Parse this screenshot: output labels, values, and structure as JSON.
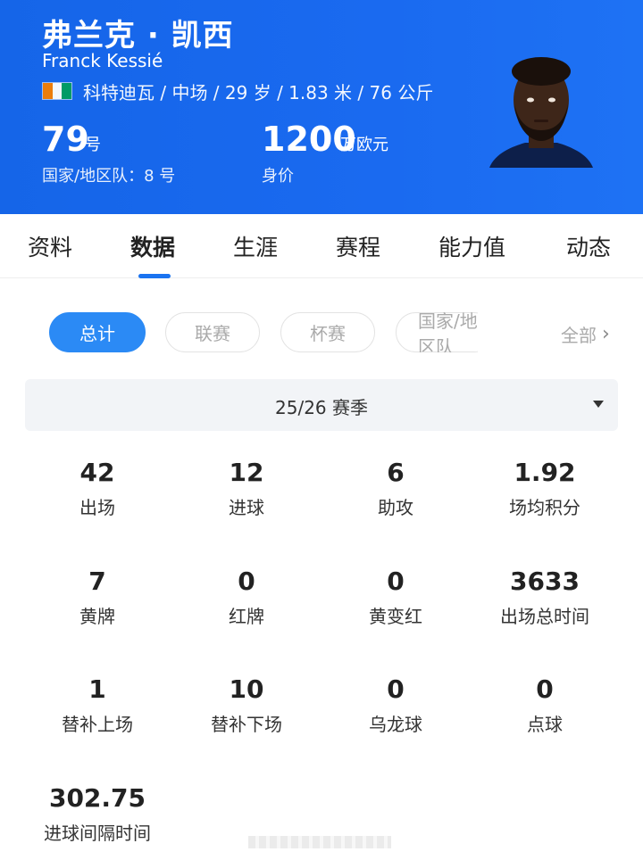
{
  "player": {
    "name_cn": "弗兰克 · 凯西",
    "name_en": "Franck Kessié",
    "info": "科特迪瓦 / 中场 / 29 岁 / 1.83 米 / 76 公斤",
    "number": "79",
    "number_unit": "号",
    "national_team": "国家/地区队：8 号",
    "market_value": "1200",
    "market_value_unit": "万欧元",
    "market_value_label": "身价",
    "flag_colors": [
      "#F77F00",
      "#FFFFFF",
      "#009E60"
    ],
    "header_color": "#1a6af0"
  },
  "tabs": [
    {
      "label": "资料"
    },
    {
      "label": "数据"
    },
    {
      "label": "生涯"
    },
    {
      "label": "赛程"
    },
    {
      "label": "能力值"
    },
    {
      "label": "动态"
    }
  ],
  "active_tab": "数据",
  "filters": [
    {
      "label": "总计"
    },
    {
      "label": "联赛"
    },
    {
      "label": "杯赛"
    },
    {
      "label": "国家/地区队"
    }
  ],
  "active_filter": "总计",
  "all_button": "全部",
  "season": "25/26 赛季",
  "stats": [
    {
      "value": "42",
      "label": "出场"
    },
    {
      "value": "12",
      "label": "进球"
    },
    {
      "value": "6",
      "label": "助攻"
    },
    {
      "value": "1.92",
      "label": "场均积分"
    },
    {
      "value": "7",
      "label": "黄牌"
    },
    {
      "value": "0",
      "label": "红牌"
    },
    {
      "value": "0",
      "label": "黄变红"
    },
    {
      "value": "3633",
      "label": "出场总时间"
    },
    {
      "value": "1",
      "label": "替补上场"
    },
    {
      "value": "10",
      "label": "替补下场"
    },
    {
      "value": "0",
      "label": "乌龙球"
    },
    {
      "value": "0",
      "label": "点球"
    },
    {
      "value": "302.75",
      "label": "进球间隔时间"
    }
  ]
}
